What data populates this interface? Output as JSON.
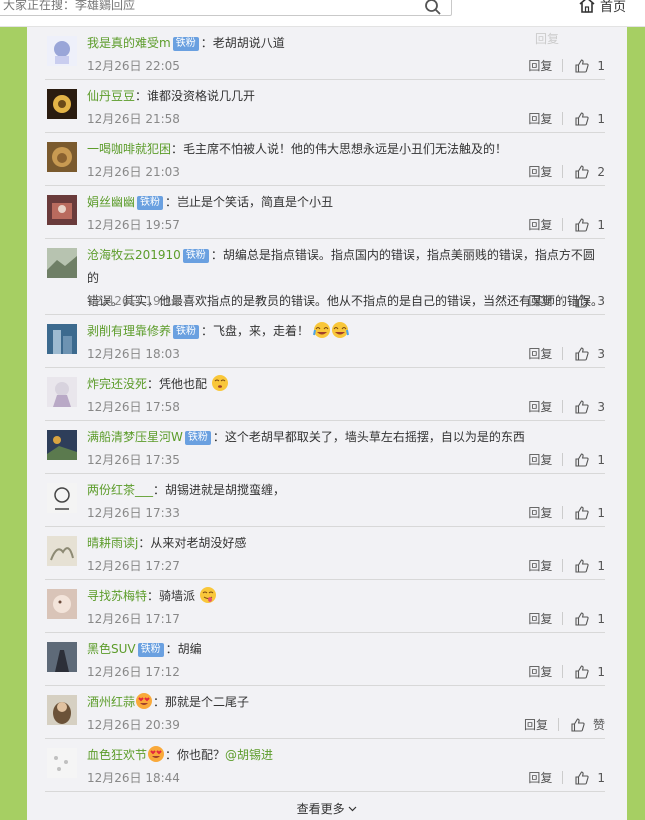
{
  "search": {
    "placeholder": "大家正在搜：李雄鷄回应"
  },
  "nav": {
    "home_label": "首页"
  },
  "panel": {
    "top_faded": "回复"
  },
  "colors": {
    "page_bg": "#a6cf63",
    "panel_bg": "#f2f2f5",
    "username": "#5c9c2a",
    "badge": "#6aa0e0"
  },
  "comments": [
    {
      "user": "我是真的难受m",
      "badge": "铁粉",
      "text": "：老胡胡说八道",
      "time": "12月26日 22:05",
      "reply": "回复",
      "likes": "1"
    },
    {
      "user": "仙丹豆豆",
      "badge": "",
      "text": "：谁都没资格说几几开",
      "time": "12月26日 21:58",
      "reply": "回复",
      "likes": "1"
    },
    {
      "user": "一喝咖啡就犯困",
      "badge": "",
      "text": "：毛主席不怕被人说！他的伟大思想永远是小丑们无法触及的！",
      "time": "12月26日 21:03",
      "reply": "回复",
      "likes": "2"
    },
    {
      "user": "娟丝幽幽",
      "badge": "铁粉",
      "text": "：岂止是个笑话，简直是个小丑",
      "time": "12月26日 19:57",
      "reply": "回复",
      "likes": "1"
    },
    {
      "user": "沧海牧云201910",
      "badge": "铁粉",
      "text": "：胡编总是指点错误。指点国内的错误，指点美丽贱的错误，指点方不圆的",
      "text2": "错误。其实，他最喜欢指点的是教员的错误。他从不指点的是自己的错误，当然还有某师的错误。",
      "time": "12月26日 19:10",
      "reply": "回复",
      "likes": "3"
    },
    {
      "user": "剥削有理靠修养",
      "badge": "铁粉",
      "text": "：飞盘，来，走着！",
      "time": "12月26日 18:03",
      "reply": "回复",
      "likes": "3"
    },
    {
      "user": "炸完还没死",
      "badge": "",
      "text": "：凭他也配",
      "time": "12月26日 17:58",
      "reply": "回复",
      "likes": "3"
    },
    {
      "user": "满船清梦压星河W",
      "badge": "铁粉",
      "text": "：这个老胡早都取关了，墙头草左右摇摆，自以为是的东西",
      "time": "12月26日 17:35",
      "reply": "回复",
      "likes": "1"
    },
    {
      "user": "两份红茶___",
      "badge": "",
      "text": "：胡锡进就是胡搅蛮缠，",
      "time": "12月26日 17:33",
      "reply": "回复",
      "likes": "1"
    },
    {
      "user": "晴耕雨读j",
      "badge": "",
      "text": "：从来对老胡没好感",
      "time": "12月26日 17:27",
      "reply": "回复",
      "likes": "1"
    },
    {
      "user": "寻找苏梅特",
      "badge": "",
      "text": "：骑墙派",
      "time": "12月26日 17:17",
      "reply": "回复",
      "likes": "1"
    },
    {
      "user": "黑色SUV",
      "badge": "铁粉",
      "text": "：胡编",
      "time": "12月26日 17:12",
      "reply": "回复",
      "likes": "1"
    },
    {
      "user": "酒州红蒜",
      "badge": "",
      "text": "：那就是个二尾子",
      "time": "12月26日 20:39",
      "reply": "回复",
      "likes": "赞"
    },
    {
      "user": "血色狂欢节",
      "badge": "",
      "text": "：你也配？",
      "mention": "@胡锡进",
      "time": "12月26日 18:44",
      "reply": "回复",
      "likes": "1"
    }
  ],
  "load_more": "查看更多"
}
